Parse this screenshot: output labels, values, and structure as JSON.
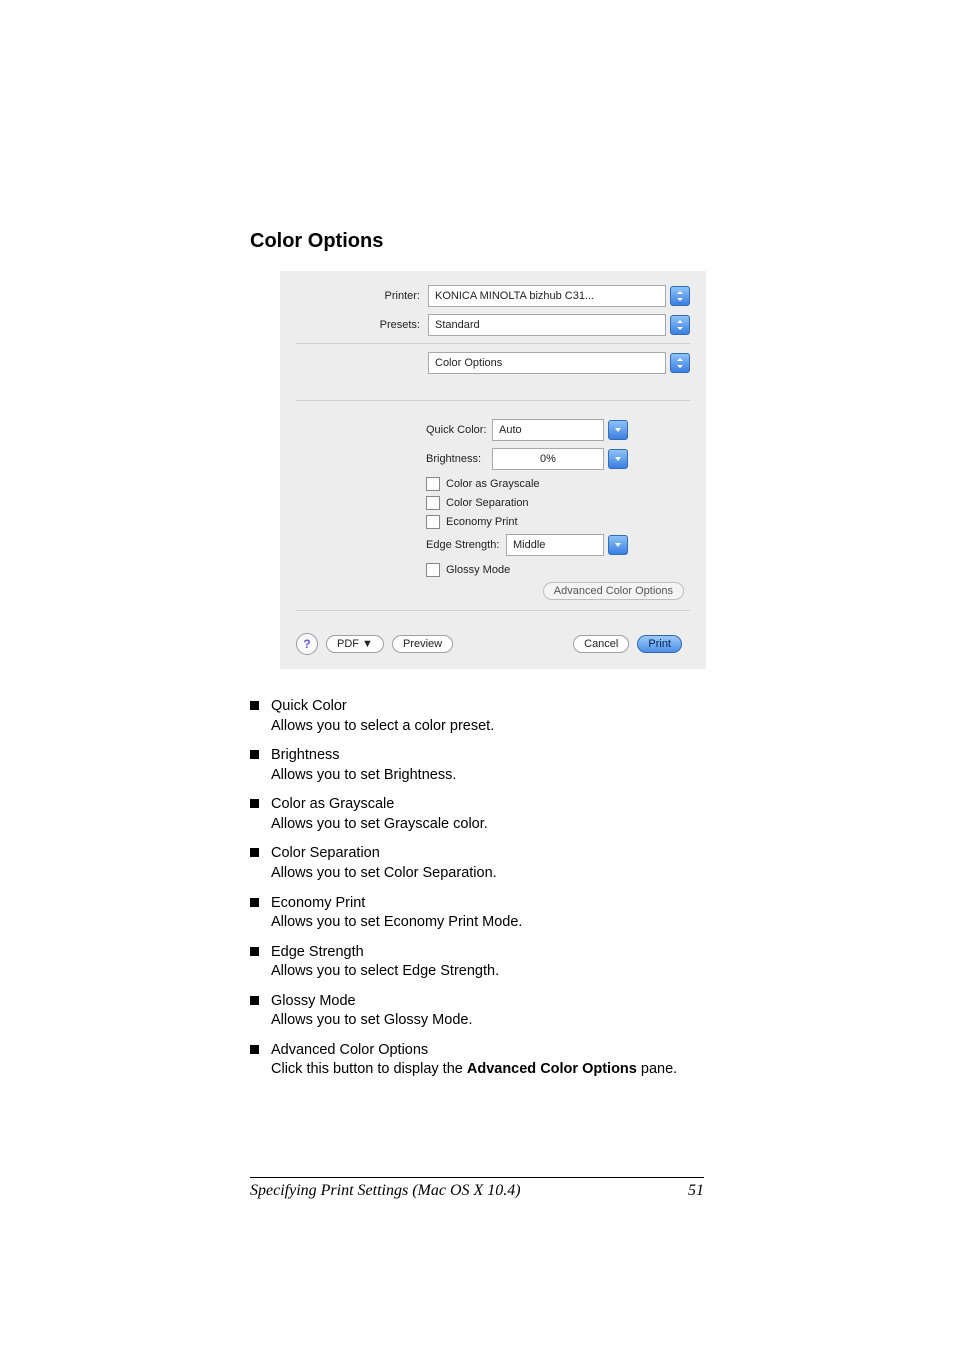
{
  "heading": "Color Options",
  "dialog": {
    "printer": {
      "label": "Printer:",
      "value": "KONICA MINOLTA bizhub C31..."
    },
    "presets": {
      "label": "Presets:",
      "value": "Standard"
    },
    "pane": {
      "value": "Color Options"
    },
    "quick_color": {
      "label": "Quick Color:",
      "value": "Auto"
    },
    "brightness": {
      "label": "Brightness:",
      "value": "0%"
    },
    "color_as_grayscale": "Color as Grayscale",
    "color_separation": "Color Separation",
    "economy_print": "Economy Print",
    "edge_strength": {
      "label": "Edge Strength:",
      "value": "Middle"
    },
    "glossy_mode": "Glossy Mode",
    "advanced_btn": "Advanced Color Options",
    "help": "?",
    "pdf": "PDF ▼",
    "preview": "Preview",
    "cancel": "Cancel",
    "print": "Print"
  },
  "bullets": [
    {
      "title": "Quick Color",
      "desc": "Allows you to select a color preset."
    },
    {
      "title": "Brightness",
      "desc": "Allows you to set Brightness."
    },
    {
      "title": "Color as Grayscale",
      "desc": "Allows you to set Grayscale color."
    },
    {
      "title": "Color Separation",
      "desc": "Allows you to set Color Separation."
    },
    {
      "title": "Economy Print",
      "desc": "Allows you to set Economy Print Mode."
    },
    {
      "title": "Edge Strength",
      "desc": "Allows you to select Edge Strength."
    },
    {
      "title": "Glossy Mode",
      "desc": "Allows you to set Glossy Mode."
    },
    {
      "title": "Advanced Color Options",
      "desc_pre": "Click this button to display the ",
      "desc_bold": "Advanced Color Options",
      "desc_post": " pane."
    }
  ],
  "footer": {
    "text": "Specifying Print Settings (Mac OS X 10.4)",
    "page": "51"
  }
}
